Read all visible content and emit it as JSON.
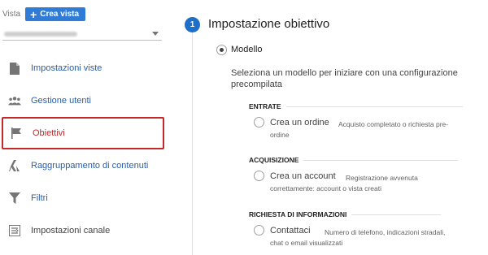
{
  "sidebar": {
    "vista_label": "Vista",
    "create_button": "Crea vista",
    "menu": [
      {
        "label": "Impostazioni viste",
        "icon": "document-icon"
      },
      {
        "label": "Gestione utenti",
        "icon": "users-icon"
      },
      {
        "label": "Obiettivi",
        "icon": "flag-icon",
        "active": true
      },
      {
        "label": "Raggruppamento di contenuti",
        "icon": "grouping-icon"
      },
      {
        "label": "Filtri",
        "icon": "filter-icon"
      },
      {
        "label": "Impostazioni canale",
        "icon": "channel-settings-icon"
      }
    ]
  },
  "main": {
    "step_number": "1",
    "step_title": "Impostazione obiettivo",
    "modello_label": "Modello",
    "description": "Seleziona un modello per iniziare con una configurazione precompilata",
    "sections": [
      {
        "heading": "ENTRATE",
        "option": "Crea un ordine",
        "desc_line1": "Acquisto completato o richiesta pre-",
        "desc_line2": "ordine"
      },
      {
        "heading": "ACQUISIZIONE",
        "option": "Crea un account",
        "desc_line1": "Registrazione avvenuta",
        "desc_line2": "correttamente: account o vista creati"
      },
      {
        "heading": "RICHIESTA DI INFORMAZIONI",
        "option": "Contattaci",
        "desc_line1": "Numero di telefono, indicazioni stradali,",
        "desc_line2": "chat o email visualizzati"
      }
    ]
  },
  "colors": {
    "accent": "#2f7bd6",
    "link": "#2a5ea8",
    "active": "#c62828"
  }
}
